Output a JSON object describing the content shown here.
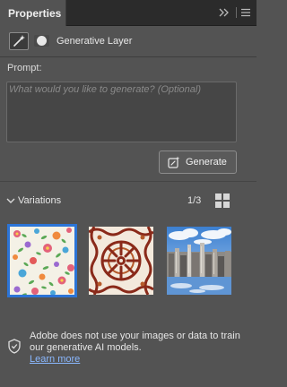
{
  "panel": {
    "tab_label": "Properties",
    "collapse_glyph": ">>",
    "layer_type_name": "Generative Layer"
  },
  "prompt": {
    "label": "Prompt:",
    "value": "",
    "placeholder": "What would you like to generate? (Optional)"
  },
  "generate_button": {
    "label": "Generate"
  },
  "variations": {
    "label": "Variations",
    "count": "1/3",
    "expanded": true,
    "selected_index": 0,
    "items": [
      {
        "description_icon": "floral-pattern-thumbnail"
      },
      {
        "description_icon": "mandala-pattern-thumbnail"
      },
      {
        "description_icon": "city-skyline-thumbnail"
      }
    ]
  },
  "notice": {
    "text": "Adobe does not use your images or data to train our generative AI models.",
    "link": "Learn more"
  },
  "colors": {
    "panel_bg": "#535353",
    "tab_bar_bg": "#2b2b2b",
    "selection_accent": "#2c74d6",
    "link": "#8ab8ff"
  }
}
